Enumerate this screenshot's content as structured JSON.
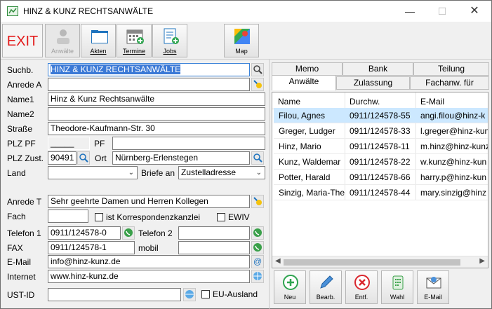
{
  "window": {
    "title": "HINZ & KUNZ RECHTSANWÄLTE",
    "minimize": "—",
    "maximize": "☐",
    "close": "✕"
  },
  "toolbar": {
    "exit": "EXIT",
    "anwaelte": "Anwälte",
    "akten": "Akten",
    "termine": "Termine",
    "jobs": "Jobs",
    "map": "Map"
  },
  "form": {
    "suchb_label": "Suchb.",
    "suchb_value": "HINZ & KUNZ RECHTSANWÄLTE",
    "anrede_a_label": "Anrede A",
    "anrede_a_value": "",
    "name1_label": "Name1",
    "name1_value": "Hinz & Kunz Rechtsanwälte",
    "name2_label": "Name2",
    "name2_value": "",
    "strasse_label": "Straße",
    "strasse_value": "Theodore-Kaufmann-Str. 30",
    "plz_pf_label": "PLZ PF",
    "plz_pf_value": "_____",
    "pf_label": "PF",
    "pf_value": "",
    "plz_zust_label": "PLZ Zust.",
    "plz_zust_value": "90491",
    "ort_label": "Ort",
    "ort_value": "Nürnberg-Erlenstegen",
    "land_label": "Land",
    "land_value": "",
    "briefe_an_label": "Briefe an",
    "briefe_an_value": "Zustelladresse",
    "anrede_t_label": "Anrede T",
    "anrede_t_value": "Sehr geehrte Damen und Herren Kollegen",
    "fach_label": "Fach",
    "fach_value": "",
    "korr_label": "ist Korrespondenzkanzlei",
    "ewiv_label": "EWIV",
    "telefon1_label": "Telefon 1",
    "telefon1_value": "0911/124578-0",
    "telefon2_label": "Telefon 2",
    "telefon2_value": "",
    "fax_label": "FAX",
    "fax_value": "0911/124578-1",
    "mobil_label": "mobil",
    "mobil_value": "",
    "email_label": "E-Mail",
    "email_value": "info@hinz-kunz.de",
    "internet_label": "Internet",
    "internet_value": "www.hinz-kunz.de",
    "ustid_label": "UST-ID",
    "ustid_value": "",
    "eu_ausland_label": "EU-Ausland"
  },
  "tabs": {
    "row1": [
      "Memo",
      "Bank",
      "Teilung"
    ],
    "row2": [
      "Anwälte",
      "Zulassung",
      "Fachanw. für"
    ]
  },
  "grid": {
    "columns": [
      "Name",
      "Durchw.",
      "E-Mail"
    ],
    "rows": [
      [
        "Filou, Agnes",
        "0911/124578-55",
        "angi.filou@hinz-k"
      ],
      [
        "Greger, Ludger",
        "0911/124578-33",
        "l.greger@hinz-kun"
      ],
      [
        "Hinz, Mario",
        "0911/124578-11",
        "m.hinz@hinz-kunz"
      ],
      [
        "Kunz, Waldemar",
        "0911/124578-22",
        "w.kunz@hinz-kun"
      ],
      [
        "Potter, Harald",
        "0911/124578-66",
        "harry.p@hinz-kun"
      ],
      [
        "Sinzig, Maria-The",
        "0911/124578-44",
        "mary.sinzig@hinz"
      ]
    ]
  },
  "actions": {
    "neu": "Neu",
    "bearb": "Bearb.",
    "entf": "Entf.",
    "wahl": "Wahl",
    "email": "E-Mail"
  },
  "colors": {
    "accent": "#3b79d6",
    "exit": "#e31b1b",
    "selected_row": "#cce8ff"
  }
}
